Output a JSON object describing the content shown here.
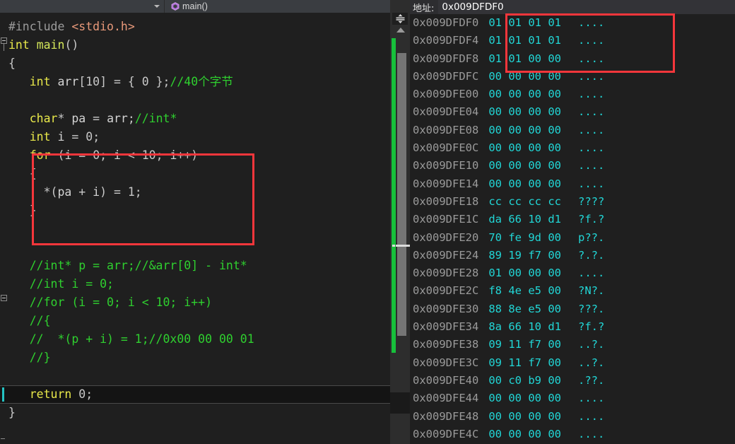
{
  "editor": {
    "nav_scope": "",
    "nav_member": "main()",
    "member_icon": "method-purple-icon",
    "scope_dropdown_icon": "chevron-down-icon",
    "member_dropdown_icon": "chevron-down-icon",
    "split_view_icon": "split-horizontal-icon",
    "scroll_up_icon": "triangle-up-icon",
    "code_lines": [
      {
        "id": "l1",
        "tokens": [
          {
            "t": "#include ",
            "c": "pre"
          },
          {
            "t": "<stdio.h>",
            "c": "hdr"
          }
        ],
        "indent": 0,
        "current": false
      },
      {
        "id": "l2",
        "tokens": [
          {
            "t": "int ",
            "c": "kw"
          },
          {
            "t": "main",
            "c": "fn"
          },
          {
            "t": "()",
            "c": "punc"
          }
        ],
        "indent": 0,
        "current": false
      },
      {
        "id": "l3",
        "tokens": [
          {
            "t": "{",
            "c": "punc"
          }
        ],
        "indent": 0,
        "current": false
      },
      {
        "id": "l4",
        "tokens": [
          {
            "t": "int ",
            "c": "kw"
          },
          {
            "t": "arr",
            "c": "id"
          },
          {
            "t": "[",
            "c": "punc"
          },
          {
            "t": "10",
            "c": "num"
          },
          {
            "t": "] = { ",
            "c": "punc"
          },
          {
            "t": "0",
            "c": "num"
          },
          {
            "t": " };",
            "c": "punc"
          },
          {
            "t": "//40个字节",
            "c": "cmt"
          }
        ],
        "indent": 3,
        "current": false
      },
      {
        "id": "l5",
        "tokens": [],
        "indent": 0,
        "current": false
      },
      {
        "id": "l6",
        "tokens": [
          {
            "t": "char",
            "c": "kw"
          },
          {
            "t": "* ",
            "c": "punc"
          },
          {
            "t": "pa",
            "c": "id"
          },
          {
            "t": " = ",
            "c": "punc"
          },
          {
            "t": "arr",
            "c": "id"
          },
          {
            "t": ";",
            "c": "punc"
          },
          {
            "t": "//int*",
            "c": "cmt"
          }
        ],
        "indent": 3,
        "current": false
      },
      {
        "id": "l7",
        "tokens": [
          {
            "t": "int ",
            "c": "kw"
          },
          {
            "t": "i",
            "c": "id"
          },
          {
            "t": " = ",
            "c": "punc"
          },
          {
            "t": "0",
            "c": "num"
          },
          {
            "t": ";",
            "c": "punc"
          }
        ],
        "indent": 3,
        "current": false
      },
      {
        "id": "l8",
        "tokens": [
          {
            "t": "for ",
            "c": "kw"
          },
          {
            "t": "(",
            "c": "punc"
          },
          {
            "t": "i",
            "c": "id"
          },
          {
            "t": " = ",
            "c": "punc"
          },
          {
            "t": "0",
            "c": "num"
          },
          {
            "t": "; ",
            "c": "punc"
          },
          {
            "t": "i",
            "c": "id"
          },
          {
            "t": " < ",
            "c": "punc"
          },
          {
            "t": "10",
            "c": "num"
          },
          {
            "t": "; ",
            "c": "punc"
          },
          {
            "t": "i",
            "c": "id"
          },
          {
            "t": "++)",
            "c": "punc"
          }
        ],
        "indent": 3,
        "current": false
      },
      {
        "id": "l9",
        "tokens": [
          {
            "t": "{",
            "c": "punc"
          }
        ],
        "indent": 3,
        "current": false
      },
      {
        "id": "l10",
        "tokens": [
          {
            "t": "*(",
            "c": "punc"
          },
          {
            "t": "pa",
            "c": "id"
          },
          {
            "t": " + ",
            "c": "punc"
          },
          {
            "t": "i",
            "c": "id"
          },
          {
            "t": ") = ",
            "c": "punc"
          },
          {
            "t": "1",
            "c": "num"
          },
          {
            "t": ";",
            "c": "punc"
          }
        ],
        "indent": 5,
        "current": false
      },
      {
        "id": "l11",
        "tokens": [
          {
            "t": "}",
            "c": "punc"
          }
        ],
        "indent": 3,
        "current": false
      },
      {
        "id": "l12",
        "tokens": [],
        "indent": 0,
        "current": false
      },
      {
        "id": "l13",
        "tokens": [],
        "indent": 0,
        "current": false
      },
      {
        "id": "l14",
        "tokens": [
          {
            "t": "//int* p = arr;//&arr[0] - int*",
            "c": "cmt"
          }
        ],
        "indent": 3,
        "current": false
      },
      {
        "id": "l15",
        "tokens": [
          {
            "t": "//int i = 0;",
            "c": "cmt"
          }
        ],
        "indent": 3,
        "current": false
      },
      {
        "id": "l16",
        "tokens": [
          {
            "t": "//for (i = 0; i < 10; i++)",
            "c": "cmt"
          }
        ],
        "indent": 3,
        "current": false
      },
      {
        "id": "l17",
        "tokens": [
          {
            "t": "//{",
            "c": "cmt"
          }
        ],
        "indent": 3,
        "current": false
      },
      {
        "id": "l18",
        "tokens": [
          {
            "t": "//  *(p + i) = 1;//0x00 00 00 01",
            "c": "cmt"
          }
        ],
        "indent": 3,
        "current": false
      },
      {
        "id": "l19",
        "tokens": [
          {
            "t": "//}",
            "c": "cmt"
          }
        ],
        "indent": 3,
        "current": false
      },
      {
        "id": "l20",
        "tokens": [],
        "indent": 0,
        "current": false
      },
      {
        "id": "l21",
        "tokens": [
          {
            "t": "return ",
            "c": "kw"
          },
          {
            "t": "0",
            "c": "num"
          },
          {
            "t": ";",
            "c": "punc"
          }
        ],
        "indent": 3,
        "current": true
      },
      {
        "id": "l22",
        "tokens": [
          {
            "t": "}",
            "c": "punc"
          }
        ],
        "indent": 0,
        "current": false
      }
    ]
  },
  "memory": {
    "address_label": "地址:",
    "address_value": "0x009DFDF0",
    "rows": [
      {
        "address": "0x009DFDF0",
        "bytes": "01 01 01 01",
        "ascii": "...."
      },
      {
        "address": "0x009DFDF4",
        "bytes": "01 01 01 01",
        "ascii": "...."
      },
      {
        "address": "0x009DFDF8",
        "bytes": "01 01 00 00",
        "ascii": "...."
      },
      {
        "address": "0x009DFDFC",
        "bytes": "00 00 00 00",
        "ascii": "...."
      },
      {
        "address": "0x009DFE00",
        "bytes": "00 00 00 00",
        "ascii": "...."
      },
      {
        "address": "0x009DFE04",
        "bytes": "00 00 00 00",
        "ascii": "...."
      },
      {
        "address": "0x009DFE08",
        "bytes": "00 00 00 00",
        "ascii": "...."
      },
      {
        "address": "0x009DFE0C",
        "bytes": "00 00 00 00",
        "ascii": "...."
      },
      {
        "address": "0x009DFE10",
        "bytes": "00 00 00 00",
        "ascii": "...."
      },
      {
        "address": "0x009DFE14",
        "bytes": "00 00 00 00",
        "ascii": "...."
      },
      {
        "address": "0x009DFE18",
        "bytes": "cc cc cc cc",
        "ascii": "????"
      },
      {
        "address": "0x009DFE1C",
        "bytes": "da 66 10 d1",
        "ascii": "?f.?"
      },
      {
        "address": "0x009DFE20",
        "bytes": "70 fe 9d 00",
        "ascii": "p??."
      },
      {
        "address": "0x009DFE24",
        "bytes": "89 19 f7 00",
        "ascii": "?.?."
      },
      {
        "address": "0x009DFE28",
        "bytes": "01 00 00 00",
        "ascii": "...."
      },
      {
        "address": "0x009DFE2C",
        "bytes": "f8 4e e5 00",
        "ascii": "?N?."
      },
      {
        "address": "0x009DFE30",
        "bytes": "88 8e e5 00",
        "ascii": "???."
      },
      {
        "address": "0x009DFE34",
        "bytes": "8a 66 10 d1",
        "ascii": "?f.?"
      },
      {
        "address": "0x009DFE38",
        "bytes": "09 11 f7 00",
        "ascii": "..?."
      },
      {
        "address": "0x009DFE3C",
        "bytes": "09 11 f7 00",
        "ascii": "..?."
      },
      {
        "address": "0x009DFE40",
        "bytes": "00 c0 b9 00",
        "ascii": ".??."
      },
      {
        "address": "0x009DFE44",
        "bytes": "00 00 00 00",
        "ascii": "...."
      },
      {
        "address": "0x009DFE48",
        "bytes": "00 00 00 00",
        "ascii": "...."
      },
      {
        "address": "0x009DFE4C",
        "bytes": "00 00 00 00",
        "ascii": "...."
      }
    ]
  },
  "annotations": {
    "code_box_name": "for-loop-highlight",
    "memory_box_name": "memory-bytes-highlight",
    "color": "#f5363b"
  }
}
